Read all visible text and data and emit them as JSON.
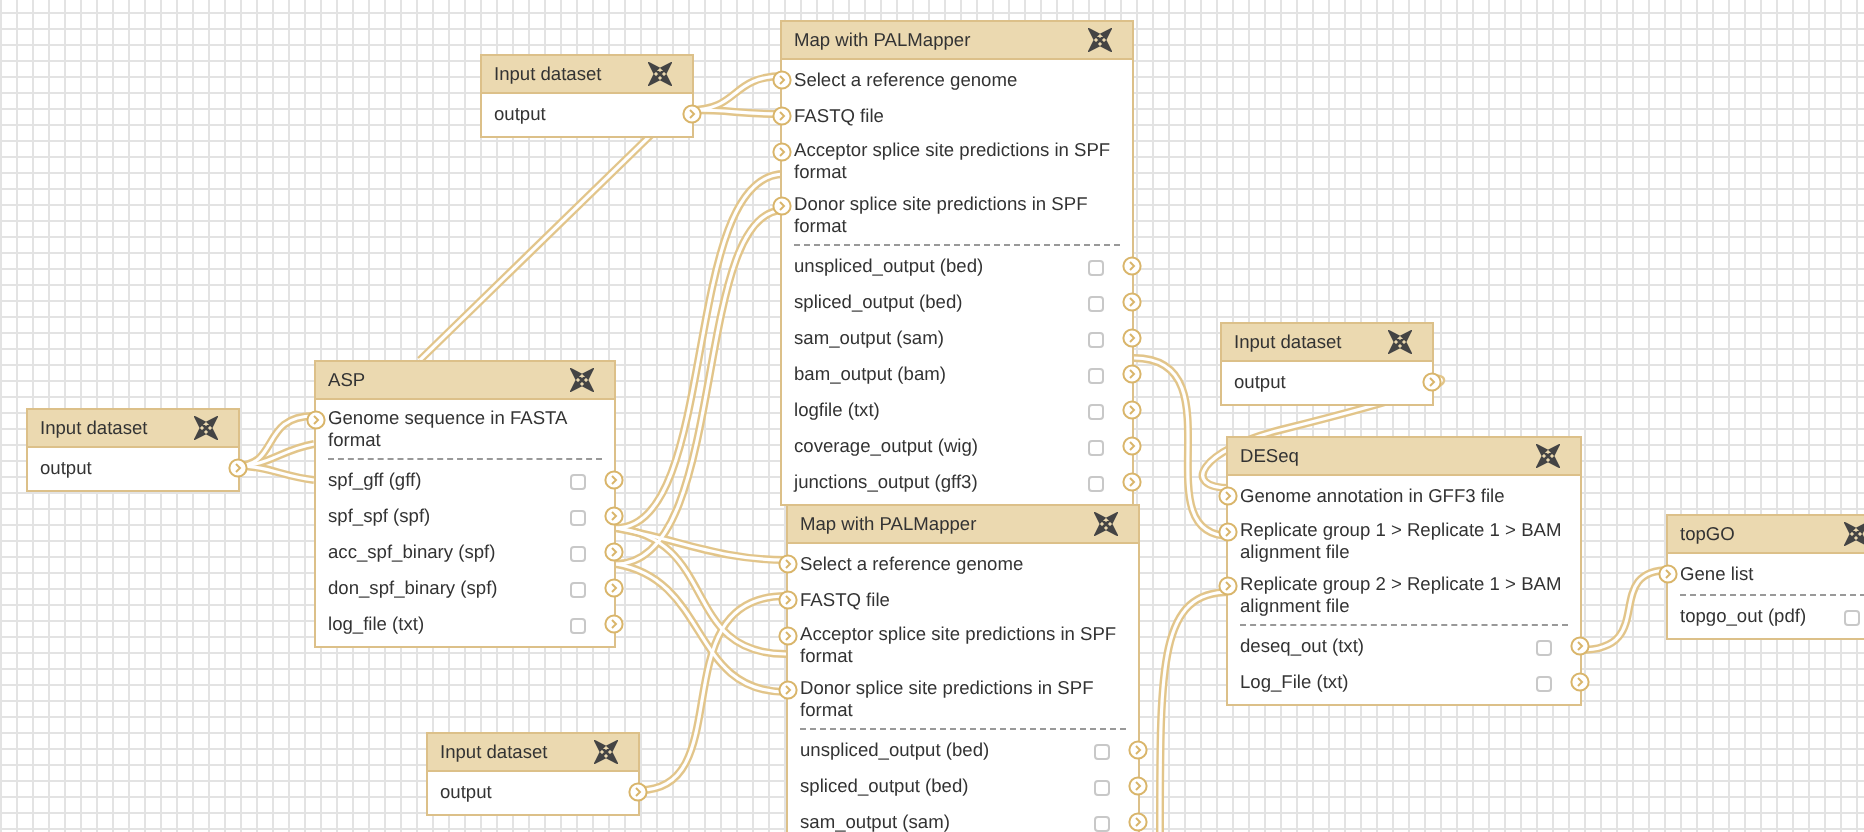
{
  "nodes": [
    {
      "title": "Input dataset",
      "outputs": [
        {
          "label": "output",
          "kind": "plain"
        }
      ]
    },
    {
      "title": "Map with PALMapper",
      "inputs": [
        "Select a reference genome",
        "FASTQ file",
        "Acceptor splice site predictions in SPF format",
        "Donor splice site predictions in SPF format"
      ],
      "outputs": [
        {
          "label": "unspliced_output (bed)",
          "checked": false,
          "kind": "marked"
        },
        {
          "label": "spliced_output (bed)",
          "checked": false,
          "kind": "marked"
        },
        {
          "label": "sam_output (sam)",
          "checked": false,
          "kind": "marked"
        },
        {
          "label": "bam_output (bam)",
          "checked": false,
          "kind": "marked"
        },
        {
          "label": "logfile (txt)",
          "checked": false,
          "kind": "marked"
        },
        {
          "label": "coverage_output (wig)",
          "checked": false,
          "kind": "marked"
        },
        {
          "label": "junctions_output (gff3)",
          "checked": false,
          "kind": "marked"
        }
      ]
    },
    {
      "title": "ASP",
      "inputs": [
        "Genome sequence in FASTA format"
      ],
      "outputs": [
        {
          "label": "spf_gff (gff)",
          "checked": false,
          "kind": "marked"
        },
        {
          "label": "spf_spf (spf)",
          "checked": false,
          "kind": "marked"
        },
        {
          "label": "acc_spf_binary (spf)",
          "checked": false,
          "kind": "marked"
        },
        {
          "label": "don_spf_binary (spf)",
          "checked": false,
          "kind": "marked"
        },
        {
          "label": "log_file (txt)",
          "checked": false,
          "kind": "marked"
        }
      ]
    },
    {
      "title": "Input dataset",
      "outputs": [
        {
          "label": "output",
          "kind": "plain"
        }
      ]
    },
    {
      "title": "Input dataset",
      "outputs": [
        {
          "label": "output",
          "kind": "plain"
        }
      ]
    },
    {
      "title": "DESeq",
      "inputs": [
        "Genome annotation in GFF3 file",
        "Replicate group 1 > Replicate 1 > BAM alignment file",
        "Replicate group 2 > Replicate 1 > BAM alignment file"
      ],
      "outputs": [
        {
          "label": "deseq_out (txt)",
          "checked": false,
          "kind": "marked"
        },
        {
          "label": "Log_File (txt)",
          "checked": false,
          "kind": "marked"
        }
      ]
    },
    {
      "title": "topGO",
      "inputs": [
        "Gene list"
      ],
      "outputs": [
        {
          "label": "topgo_out (pdf)",
          "checked": false,
          "kind": "marked"
        }
      ]
    },
    {
      "title": "Map with PALMapper",
      "inputs": [
        "Select a reference genome",
        "FASTQ file",
        "Acceptor splice site predictions in SPF format",
        "Donor splice site predictions in SPF format"
      ],
      "outputs": [
        {
          "label": "unspliced_output (bed)",
          "checked": false,
          "kind": "marked"
        },
        {
          "label": "spliced_output (bed)",
          "checked": false,
          "kind": "marked"
        },
        {
          "label": "sam_output (sam)",
          "checked": false,
          "kind": "marked"
        }
      ]
    },
    {
      "title": "Input dataset",
      "outputs": [
        {
          "label": "output",
          "kind": "plain"
        }
      ]
    }
  ]
}
